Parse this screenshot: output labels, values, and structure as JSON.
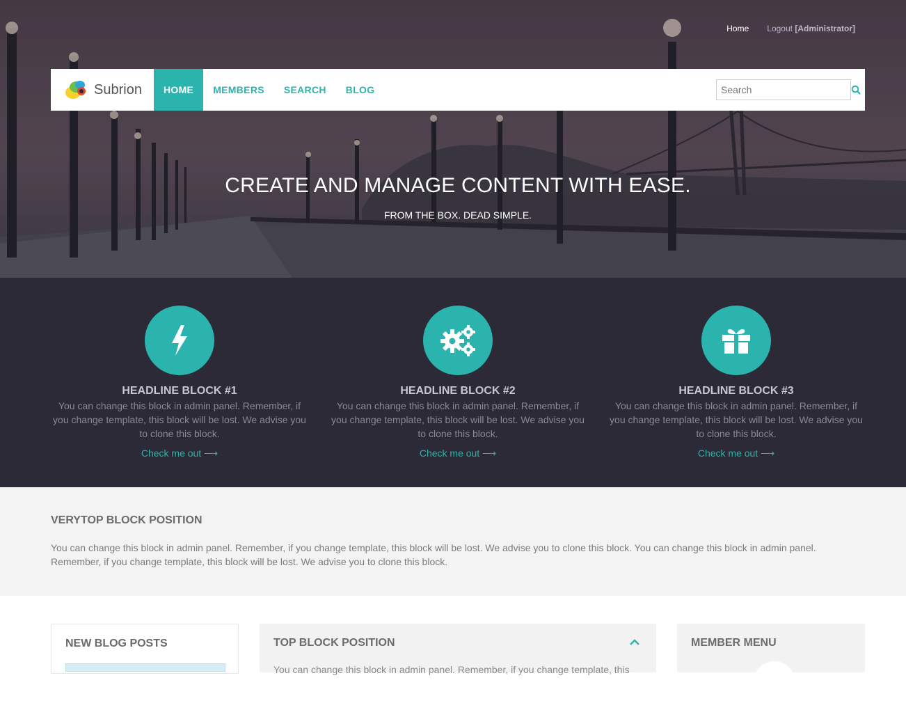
{
  "top_links": {
    "home": "Home",
    "logout": "Logout",
    "user": "[Administrator]"
  },
  "logo": {
    "text": "Subrion"
  },
  "nav": [
    {
      "label": "HOME",
      "active": true
    },
    {
      "label": "MEMBERS",
      "active": false
    },
    {
      "label": "SEARCH",
      "active": false
    },
    {
      "label": "BLOG",
      "active": false
    }
  ],
  "search": {
    "placeholder": "Search",
    "icon": "search-icon"
  },
  "hero": {
    "title": "CREATE AND MANAGE CONTENT WITH EASE.",
    "subtitle": "FROM THE BOX. DEAD SIMPLE."
  },
  "features": [
    {
      "icon": "bolt-icon",
      "title": "HEADLINE BLOCK #1",
      "text": "You can change this block in admin panel. Remember, if you change template, this block will be lost. We advise you to clone this block.",
      "link": "Check me out"
    },
    {
      "icon": "gears-icon",
      "title": "HEADLINE BLOCK #2",
      "text": "You can change this block in admin panel. Remember, if you change template, this block will be lost. We advise you to clone this block.",
      "link": "Check me out"
    },
    {
      "icon": "gift-icon",
      "title": "HEADLINE BLOCK #3",
      "text": "You can change this block in admin panel. Remember, if you change template, this block will be lost. We advise you to clone this block.",
      "link": "Check me out"
    }
  ],
  "verytop": {
    "title": "VERYTOP BLOCK POSITION",
    "text": "You can change this block in admin panel. Remember, if you change template, this block will be lost. We advise you to clone this block. You can change this block in admin panel. Remember, if you change template, this block will be lost. We advise you to clone this block."
  },
  "boxes": {
    "blog_title": "NEW BLOG POSTS",
    "top_title": "TOP BLOCK POSITION",
    "top_text_peek": "You can change this block in admin panel. Remember, if you change template, this",
    "member_title": "MEMBER MENU"
  },
  "colors": {
    "accent": "#2bb4ad",
    "dark_band": "#2b2a36",
    "light_band": "#f3f3f3"
  }
}
